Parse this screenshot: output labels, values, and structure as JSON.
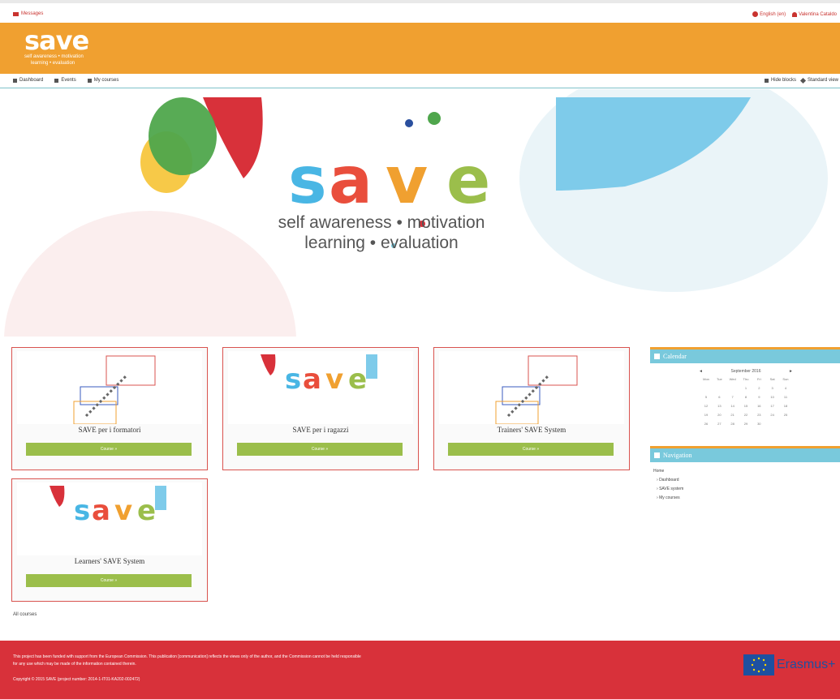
{
  "topbar": {
    "messages_label": "Messages",
    "language_label": "English (en)",
    "user_label": "Valentina Cataldo"
  },
  "brand": {
    "logo_word": "save",
    "tagline_line1": "self awareness • motivation",
    "tagline_line2": "learning • evaluation"
  },
  "nav": {
    "items": [
      {
        "label": "Dashboard"
      },
      {
        "label": "Events"
      },
      {
        "label": "My courses"
      }
    ],
    "hide_blocks_label": "Hide blocks",
    "standard_view_label": "Standard view"
  },
  "hero": {
    "tagline_line1": "self awareness • motivation",
    "tagline_line2": "learning • evaluation"
  },
  "courses": [
    {
      "title": "SAVE per i formatori",
      "button": "Course »"
    },
    {
      "title": "SAVE per i ragazzi",
      "button": "Course »"
    },
    {
      "title": "Trainers' SAVE System",
      "button": "Course »"
    },
    {
      "title": "Learners' SAVE System",
      "button": "Course »"
    }
  ],
  "calendar": {
    "title": "Calendar",
    "month": "September 2016",
    "prev": "◄",
    "next": "►",
    "weekdays": [
      "Mon",
      "Tue",
      "Wed",
      "Thu",
      "Fri",
      "Sat",
      "Sun"
    ],
    "weeks": [
      [
        "",
        "",
        "",
        "1",
        "2",
        "3",
        "4"
      ],
      [
        "5",
        "6",
        "7",
        "8",
        "9",
        "10",
        "11"
      ],
      [
        "12",
        "13",
        "14",
        "15",
        "16",
        "17",
        "18"
      ],
      [
        "19",
        "20",
        "21",
        "22",
        "23",
        "24",
        "25"
      ],
      [
        "26",
        "27",
        "28",
        "29",
        "30",
        "",
        ""
      ]
    ]
  },
  "navigation": {
    "title": "Navigation",
    "home": "Home",
    "items": [
      "Dashboard",
      "SAVE system",
      "My courses"
    ]
  },
  "all_courses_label": "All courses",
  "footer": {
    "text_line1": "This project has been funded with support from the European Commission. This publication [communication] reflects the views only of the author, and the Commission cannot be held responsible",
    "text_line2": "for any use which may be made of the information contained therein.",
    "copyright": "Copyright © 2015 SAVE (project number: 2014-1-IT01-KA202-002472)",
    "erasmus_label": "Erasmus+"
  },
  "colors": {
    "brand_orange": "#f0a030",
    "accent_red": "#d8313a",
    "button_green": "#9bbe4b",
    "block_header": "#79c9dc"
  }
}
